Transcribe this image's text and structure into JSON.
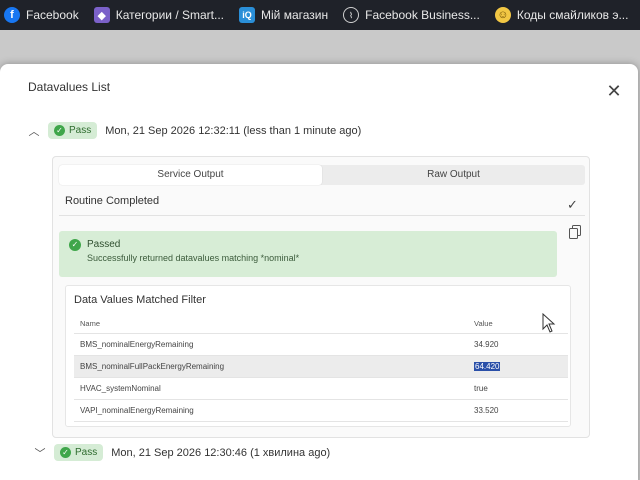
{
  "bookmarks": [
    {
      "icon": "facebook-icon",
      "glyph": "f",
      "label": "Facebook"
    },
    {
      "icon": "cube-icon",
      "glyph": "◆",
      "label": "Категории / Smart..."
    },
    {
      "icon": "iq-icon",
      "glyph": "iQ",
      "label": "Мій магазин"
    },
    {
      "icon": "facebook-business-icon",
      "glyph": "⌇",
      "label": "Facebook Business..."
    },
    {
      "icon": "smiley-icon",
      "glyph": "☺",
      "label": "Коды смайликов э..."
    }
  ],
  "modal": {
    "title": "Datavalues List",
    "close_glyph": "✕"
  },
  "runs": [
    {
      "chevron": "︿",
      "status": "Pass",
      "timestamp": "Mon, 21 Sep 2026 12:32:11 (less than 1 minute ago)"
    },
    {
      "chevron": "﹀",
      "status": "Pass",
      "timestamp": "Mon, 21 Sep 2026 12:30:46 (1 хвилина ago)"
    }
  ],
  "tabs": [
    {
      "label": "Service Output",
      "active": true
    },
    {
      "label": "Raw Output",
      "active": false
    }
  ],
  "routine": {
    "text": "Routine Completed",
    "check_glyph": "✓"
  },
  "result": {
    "title": "Passed",
    "message": "Successfully returned datavalues matching *nominal*"
  },
  "datavalues": {
    "title": "Data Values Matched Filter",
    "columns": {
      "name": "Name",
      "value": "Value"
    },
    "rows": [
      {
        "name": "BMS_nominalEnergyRemaining",
        "value": "34.920"
      },
      {
        "name": "BMS_nominalFullPackEnergyRemaining",
        "value": "64.420"
      },
      {
        "name": "HVAC_systemNominal",
        "value": "true"
      },
      {
        "name": "VAPI_nominalEnergyRemaining",
        "value": "33.520"
      }
    ]
  },
  "colors": {
    "pass_green": "#3fa64a",
    "pass_bg": "#d7edd6",
    "selection": "#2a4fa8"
  }
}
